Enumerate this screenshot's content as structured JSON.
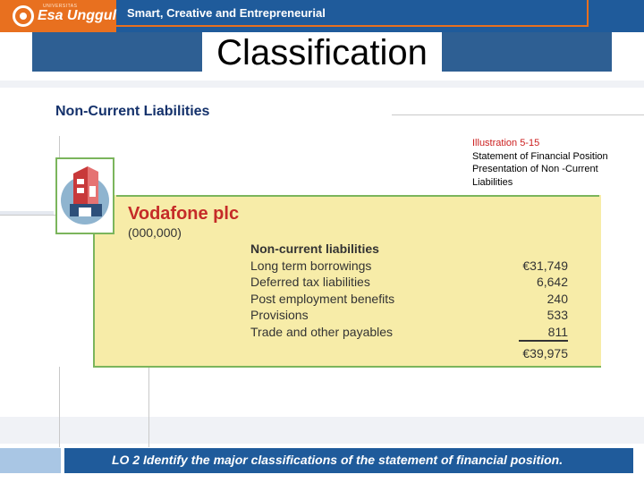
{
  "header": {
    "brand_small": "UNIVERSITAS",
    "brand": "Esa Unggul",
    "tagline": "Smart, Creative and Entrepreneurial"
  },
  "slide": {
    "title": "Classification",
    "subtitle": "Non-Current Liabilities"
  },
  "illustration": {
    "number": "Illustration 5-15",
    "caption": "Statement of Financial Position Presentation of Non -Current Liabilities"
  },
  "statement": {
    "company": "Vodafone plc",
    "units": "(000,000)",
    "section_heading": "Non-current liabilities",
    "rows": [
      {
        "label": "Long term borrowings",
        "value": "€31,749"
      },
      {
        "label": "Deferred tax liabilities",
        "value": "6,642"
      },
      {
        "label": "Post employment benefits",
        "value": "240"
      },
      {
        "label": "Provisions",
        "value": "533"
      },
      {
        "label": "Trade and other payables",
        "value": "811"
      }
    ],
    "total": "€39,975"
  },
  "footer": {
    "text": "LO 2  Identify the major classifications of the statement of financial position."
  }
}
